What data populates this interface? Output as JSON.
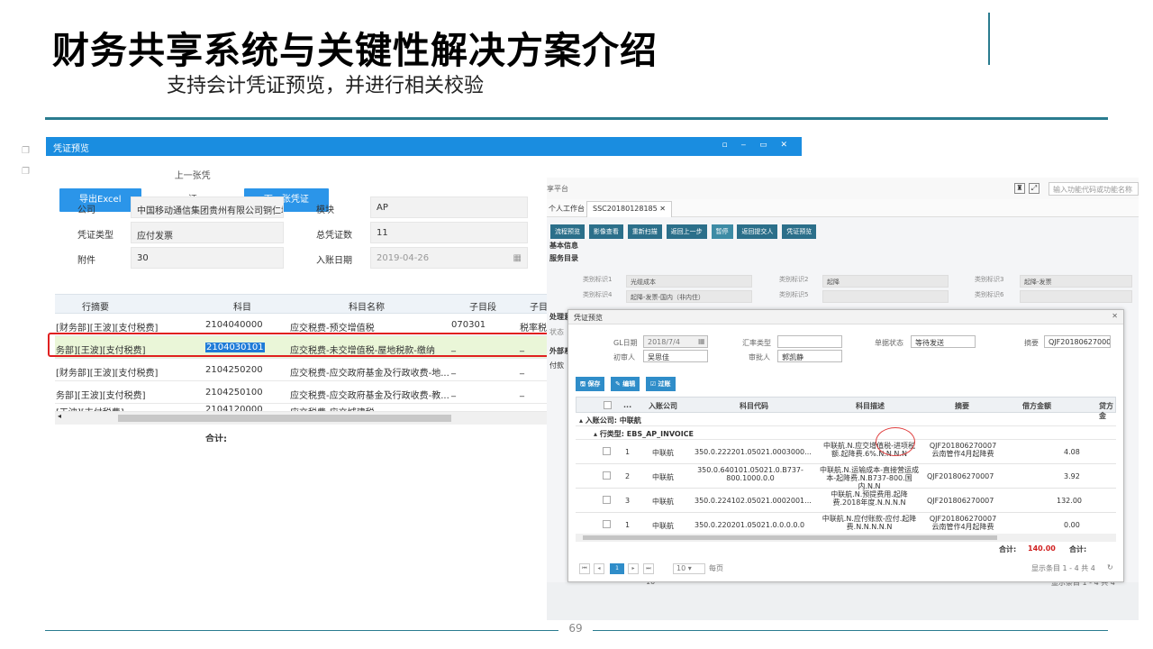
{
  "slide": {
    "title": "财务共享系统与关键性解决方案介绍",
    "subtitle": "支持会计凭证预览，并进行相关校验",
    "page_number": "69"
  },
  "window1": {
    "title": "凭证预览",
    "buttons": {
      "export": "导出Excel",
      "prev": "上一张凭证",
      "next": "下一张凭证"
    },
    "fields": {
      "company_label": "公司",
      "company_value": "中国移动通信集团贵州有限公司铜仁地区",
      "module_label": "模块",
      "module_value": "AP",
      "type_label": "凭证类型",
      "type_value": "应付发票",
      "count_label": "总凭证数",
      "count_value": "11",
      "attach_label": "附件",
      "attach_value": "30",
      "date_label": "入账日期",
      "date_value": "2019-04-26"
    },
    "grid": {
      "headers": [
        "行摘要",
        "科目",
        "科目名称",
        "子目段",
        "子目"
      ],
      "rows": [
        {
          "summary": "[财务部][王波][支付税费]",
          "account": "2104040000",
          "name": "应交税费-预交增值税",
          "sub": "070301",
          "sub2": "税率税"
        },
        {
          "summary": "务部][王波][支付税费]",
          "account": "2104030101",
          "name": "应交税费-未交增值税-屋地税款-缴纳",
          "sub": "_",
          "sub2": "_"
        },
        {
          "summary": "[财务部][王波][支付税费]",
          "account": "2104250200",
          "name": "应交税费-应交政府基金及行政收费-地...",
          "sub": "_",
          "sub2": "_"
        },
        {
          "summary": "务部][王波][支付税费]",
          "account": "2104250100",
          "name": "应交税费-应交政府基金及行政收费-教...",
          "sub": "_",
          "sub2": "_"
        },
        {
          "summary": "[王波][支付税费]",
          "account": "2104120000",
          "name": "应交税费-应交城建税",
          "sub": "",
          "sub2": ""
        }
      ],
      "total_label": "合计:"
    }
  },
  "window2": {
    "topbar_name": "享平台",
    "search_placeholder": "输入功能代码或功能名称",
    "tabs": {
      "home": "个人工作台",
      "active": "SSC20180128185"
    },
    "buttons": [
      "流程预览",
      "影像查看",
      "重新扫描",
      "返回上一步",
      "暂停",
      "返回提交人",
      "凭证预览"
    ],
    "sections": {
      "basic": "基本信息",
      "service": "服务目录",
      "process": "处理意见",
      "status": "状态",
      "external": "外部系统",
      "pay": "付款"
    },
    "conds": {
      "l1": "类别标识1",
      "v1": "光缆成本",
      "l2": "类别标识2",
      "v2": "起降",
      "l3": "类别标识3",
      "v3": "起降-发票",
      "l4": "类别标识4",
      "v4": "起降-发票-国内（非内住）",
      "l5": "类别标识5",
      "v5": "",
      "l6": "类别标识6",
      "v6": ""
    },
    "bottom_status": "显示条目 1 - 4 共 4",
    "bottom_page": "10"
  },
  "dialog": {
    "title": "凭证预览",
    "fields": {
      "gl_label": "GL日期",
      "gl_value": "2018/7/4",
      "rate_label": "汇率类型",
      "rate_value": "",
      "state_label": "单据状态",
      "state_value": "等待发送",
      "memo_label": "摘要",
      "memo_value": "QJF20180627000",
      "reviewer_label": "初审人",
      "reviewer_value": "吴思佳",
      "approver_label": "审批人",
      "approver_value": "郭凯静"
    },
    "buttons": [
      "保存",
      "编辑",
      "过账"
    ],
    "grid_headers": [
      "...",
      "入账公司",
      "科目代码",
      "科目描述",
      "摘要",
      "借方金额",
      "贷方金"
    ],
    "group1": "入账公司: 中联航",
    "group2": "行类型: EBS_AP_INVOICE",
    "rows": [
      {
        "n": "1",
        "company": "中联航",
        "code": "350.0.222201.05021.0003000...",
        "desc": "中联航.N.应交增值税-进项税额.起降费.6%.N.N.N.N",
        "memo": "QJF201806270007 云南管作4月起降费",
        "debit": "4.08"
      },
      {
        "n": "2",
        "company": "中联航",
        "code": "350.0.640101.05021.0.B737-800.1000.0.0",
        "desc": "中联航.N.运输成本-直接营运成本-起降费.N.B737-800.国内.N.N",
        "memo": "QJF201806270007",
        "debit": "3.92"
      },
      {
        "n": "3",
        "company": "中联航",
        "code": "350.0.224102.05021.0002001...",
        "desc": "中联航.N.预提费用.起降费.2018年度.N.N.N.N",
        "memo": "QJF201806270007",
        "debit": "132.00"
      },
      {
        "n": "1",
        "company": "中联航",
        "code": "350.0.220201.05021.0.0.0.0.0",
        "desc": "中联航.N.应付账款-应付.起降费.N.N.N.N.N",
        "memo": "QJF201806270007 云南管作4月起降费",
        "debit": "0.00"
      }
    ],
    "sum_label": "合计:",
    "sum_debit": "140.00",
    "sum_credit_label": "合计:",
    "pager": {
      "page": "1",
      "size": "10",
      "unit": "每页",
      "status": "显示条目 1 - 4 共 4"
    }
  }
}
